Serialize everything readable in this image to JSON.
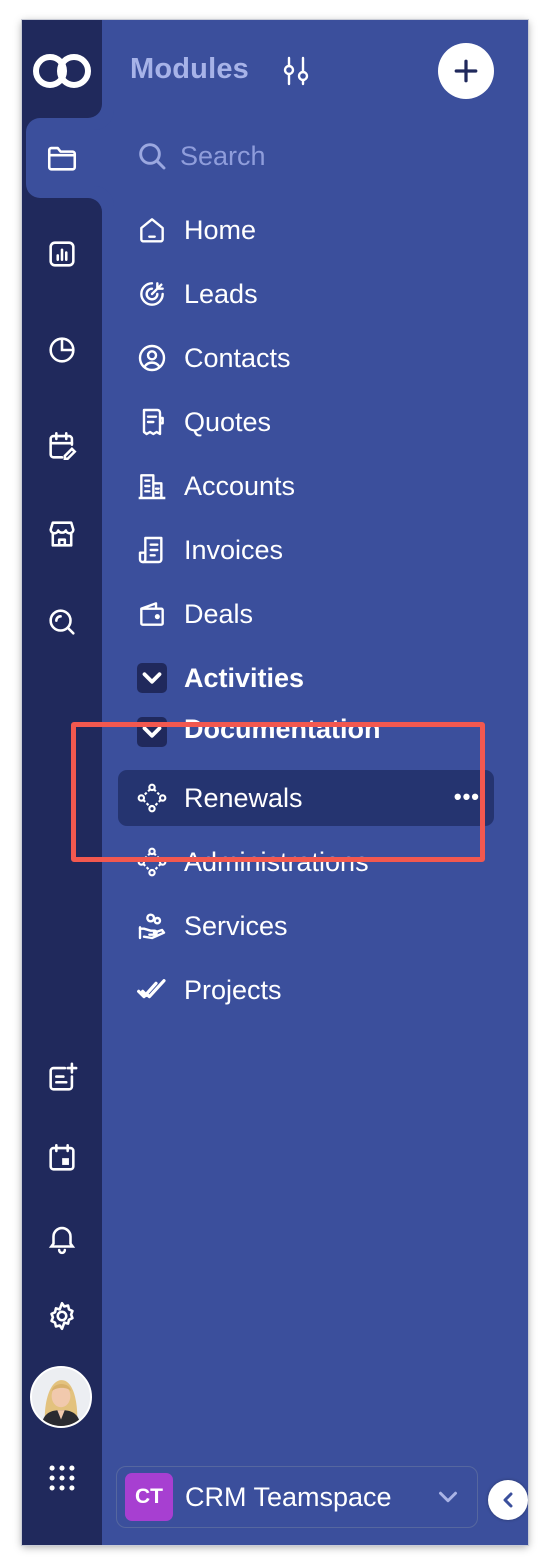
{
  "panel": {
    "title": "Modules",
    "search_placeholder": "Search"
  },
  "modules": [
    {
      "label": "Home",
      "icon": "home-icon"
    },
    {
      "label": "Leads",
      "icon": "target-icon"
    },
    {
      "label": "Contacts",
      "icon": "contact-icon"
    },
    {
      "label": "Quotes",
      "icon": "receipt-icon"
    },
    {
      "label": "Accounts",
      "icon": "building-icon"
    },
    {
      "label": "Invoices",
      "icon": "invoice-icon"
    },
    {
      "label": "Deals",
      "icon": "wallet-icon"
    },
    {
      "label": "Activities",
      "icon": "chevron-down-icon",
      "group": true
    },
    {
      "label": "Documentation",
      "icon": "chevron-down-icon",
      "group": true
    },
    {
      "label": "Renewals",
      "icon": "nodes-icon",
      "selected": true,
      "more": "•••"
    },
    {
      "label": "Administrations",
      "icon": "nodes-icon"
    },
    {
      "label": "Services",
      "icon": "hand-service-icon"
    },
    {
      "label": "Projects",
      "icon": "double-check-icon"
    }
  ],
  "team": {
    "badge": "CT",
    "name": "CRM Teamspace"
  },
  "colors": {
    "rail_bg": "#20295c",
    "panel_bg": "#3b4f9c",
    "selected_bg": "#253470",
    "highlight": "#f2584f",
    "team_badge": "#a73fd1"
  }
}
